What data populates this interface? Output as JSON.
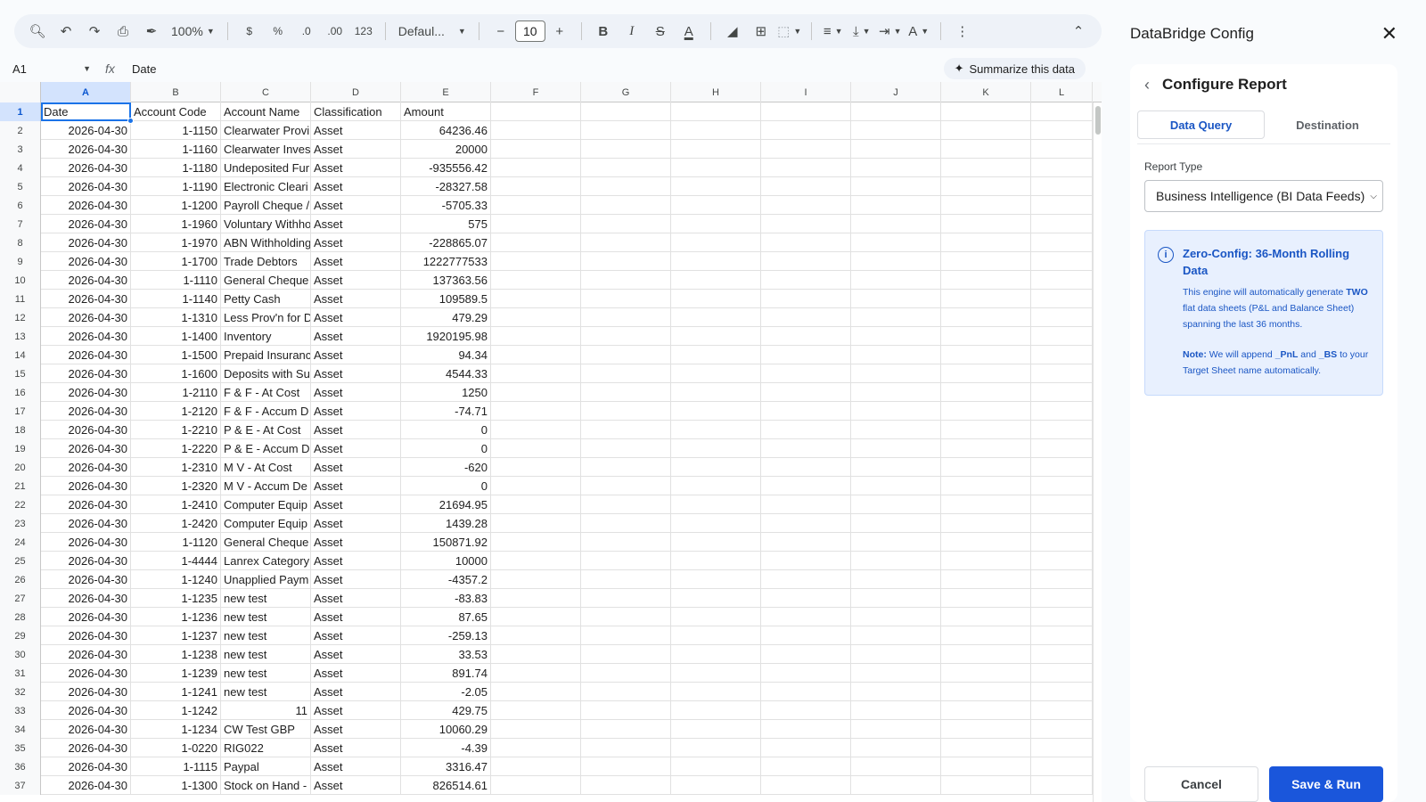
{
  "toolbar": {
    "zoom": "100%",
    "currency": "$",
    "percent": "%",
    "decrease_decimal": ".0",
    "increase_decimal": ".00",
    "number_format": "123",
    "font_name": "Defaul...",
    "font_size": "10",
    "bold": "B",
    "italic": "I",
    "strike": "S",
    "text_color": "A",
    "text_rotate": "A"
  },
  "formula_bar": {
    "cell_ref": "A1",
    "fx": "fx",
    "value": "Date",
    "summarize_label": "Summarize this data"
  },
  "columns": [
    "A",
    "B",
    "C",
    "D",
    "E",
    "F",
    "G",
    "H",
    "I",
    "J",
    "K",
    "L"
  ],
  "headers": {
    "date": "Date",
    "code": "Account Code",
    "name": "Account Name",
    "classification": "Classification",
    "amount": "Amount"
  },
  "rows": [
    {
      "n": "2",
      "date": "2026-04-30",
      "code": "1-1150",
      "name": "Clearwater Provi",
      "cls": "Asset",
      "amount": "64236.46"
    },
    {
      "n": "3",
      "date": "2026-04-30",
      "code": "1-1160",
      "name": "Clearwater Inves",
      "cls": "Asset",
      "amount": "20000"
    },
    {
      "n": "4",
      "date": "2026-04-30",
      "code": "1-1180",
      "name": "Undeposited Fur",
      "cls": "Asset",
      "amount": "-935556.42"
    },
    {
      "n": "5",
      "date": "2026-04-30",
      "code": "1-1190",
      "name": "Electronic Cleari",
      "cls": "Asset",
      "amount": "-28327.58"
    },
    {
      "n": "6",
      "date": "2026-04-30",
      "code": "1-1200",
      "name": "Payroll Cheque /",
      "cls": "Asset",
      "amount": "-5705.33"
    },
    {
      "n": "7",
      "date": "2026-04-30",
      "code": "1-1960",
      "name": "Voluntary Withho",
      "cls": "Asset",
      "amount": "575"
    },
    {
      "n": "8",
      "date": "2026-04-30",
      "code": "1-1970",
      "name": "ABN Withholding",
      "cls": "Asset",
      "amount": "-228865.07"
    },
    {
      "n": "9",
      "date": "2026-04-30",
      "code": "1-1700",
      "name": "Trade Debtors",
      "cls": "Asset",
      "amount": "1222777533"
    },
    {
      "n": "10",
      "date": "2026-04-30",
      "code": "1-1110",
      "name": "General Cheque",
      "cls": "Asset",
      "amount": "137363.56"
    },
    {
      "n": "11",
      "date": "2026-04-30",
      "code": "1-1140",
      "name": "Petty Cash",
      "cls": "Asset",
      "amount": "109589.5"
    },
    {
      "n": "12",
      "date": "2026-04-30",
      "code": "1-1310",
      "name": "Less Prov'n for D",
      "cls": "Asset",
      "amount": "479.29"
    },
    {
      "n": "13",
      "date": "2026-04-30",
      "code": "1-1400",
      "name": "Inventory",
      "cls": "Asset",
      "amount": "1920195.98"
    },
    {
      "n": "14",
      "date": "2026-04-30",
      "code": "1-1500",
      "name": "Prepaid Insuranc",
      "cls": "Asset",
      "amount": "94.34"
    },
    {
      "n": "15",
      "date": "2026-04-30",
      "code": "1-1600",
      "name": "Deposits with Su",
      "cls": "Asset",
      "amount": "4544.33"
    },
    {
      "n": "16",
      "date": "2026-04-30",
      "code": "1-2110",
      "name": "F & F  - At Cost",
      "cls": "Asset",
      "amount": "1250"
    },
    {
      "n": "17",
      "date": "2026-04-30",
      "code": "1-2120",
      "name": "F & F - Accum  D",
      "cls": "Asset",
      "amount": "-74.71"
    },
    {
      "n": "18",
      "date": "2026-04-30",
      "code": "1-2210",
      "name": "P & E - At Cost",
      "cls": "Asset",
      "amount": "0"
    },
    {
      "n": "19",
      "date": "2026-04-30",
      "code": "1-2220",
      "name": "P & E - Accum D",
      "cls": "Asset",
      "amount": "0"
    },
    {
      "n": "20",
      "date": "2026-04-30",
      "code": "1-2310",
      "name": "M V - At Cost",
      "cls": "Asset",
      "amount": "-620"
    },
    {
      "n": "21",
      "date": "2026-04-30",
      "code": "1-2320",
      "name": "M V - Accum De",
      "cls": "Asset",
      "amount": "0"
    },
    {
      "n": "22",
      "date": "2026-04-30",
      "code": "1-2410",
      "name": "Computer Equip",
      "cls": "Asset",
      "amount": "21694.95"
    },
    {
      "n": "23",
      "date": "2026-04-30",
      "code": "1-2420",
      "name": "Computer Equip",
      "cls": "Asset",
      "amount": "1439.28"
    },
    {
      "n": "24",
      "date": "2026-04-30",
      "code": "1-1120",
      "name": "General Cheque",
      "cls": "Asset",
      "amount": "150871.92"
    },
    {
      "n": "25",
      "date": "2026-04-30",
      "code": "1-4444",
      "name": "Lanrex Category",
      "cls": "Asset",
      "amount": "10000"
    },
    {
      "n": "26",
      "date": "2026-04-30",
      "code": "1-1240",
      "name": "Unapplied Paym",
      "cls": "Asset",
      "amount": "-4357.2"
    },
    {
      "n": "27",
      "date": "2026-04-30",
      "code": "1-1235",
      "name": "new test",
      "cls": "Asset",
      "amount": "-83.83"
    },
    {
      "n": "28",
      "date": "2026-04-30",
      "code": "1-1236",
      "name": "new test",
      "cls": "Asset",
      "amount": "87.65"
    },
    {
      "n": "29",
      "date": "2026-04-30",
      "code": "1-1237",
      "name": "new test",
      "cls": "Asset",
      "amount": "-259.13"
    },
    {
      "n": "30",
      "date": "2026-04-30",
      "code": "1-1238",
      "name": "new test",
      "cls": "Asset",
      "amount": "33.53"
    },
    {
      "n": "31",
      "date": "2026-04-30",
      "code": "1-1239",
      "name": "new test",
      "cls": "Asset",
      "amount": "891.74"
    },
    {
      "n": "32",
      "date": "2026-04-30",
      "code": "1-1241",
      "name": "new test",
      "cls": "Asset",
      "amount": "-2.05"
    },
    {
      "n": "33",
      "date": "2026-04-30",
      "code": "1-1242",
      "name": "11",
      "cls": "Asset",
      "amount": "429.75"
    },
    {
      "n": "34",
      "date": "2026-04-30",
      "code": "1-1234",
      "name": "CW Test  GBP",
      "cls": "Asset",
      "amount": "10060.29"
    },
    {
      "n": "35",
      "date": "2026-04-30",
      "code": "1-0220",
      "name": "RIG022",
      "cls": "Asset",
      "amount": "-4.39"
    },
    {
      "n": "36",
      "date": "2026-04-30",
      "code": "1-1115",
      "name": "Paypal",
      "cls": "Asset",
      "amount": "3316.47"
    },
    {
      "n": "37",
      "date": "2026-04-30",
      "code": "1-1300",
      "name": "Stock on Hand -",
      "cls": "Asset",
      "amount": "826514.61"
    }
  ],
  "panel": {
    "title": "DataBridge Config",
    "card_title": "Configure Report",
    "tabs": [
      "Data Query",
      "Destination"
    ],
    "report_type_label": "Report Type",
    "report_type_value": "Business Intelligence (BI Data Feeds)",
    "info_title": "Zero-Config: 36-Month Rolling Data",
    "info_text_1a": "This engine will automatically generate ",
    "info_text_1b": "TWO",
    "info_text_1c": " flat data sheets (P&L and Balance Sheet) spanning the last 36 months.",
    "info_note_label": "Note:",
    "info_note_a": " We will append ",
    "info_note_pnl": "_PnL",
    "info_note_b": " and ",
    "info_note_bs": "_BS",
    "info_note_c": " to your Target Sheet name automatically.",
    "cancel": "Cancel",
    "save": "Save & Run"
  }
}
